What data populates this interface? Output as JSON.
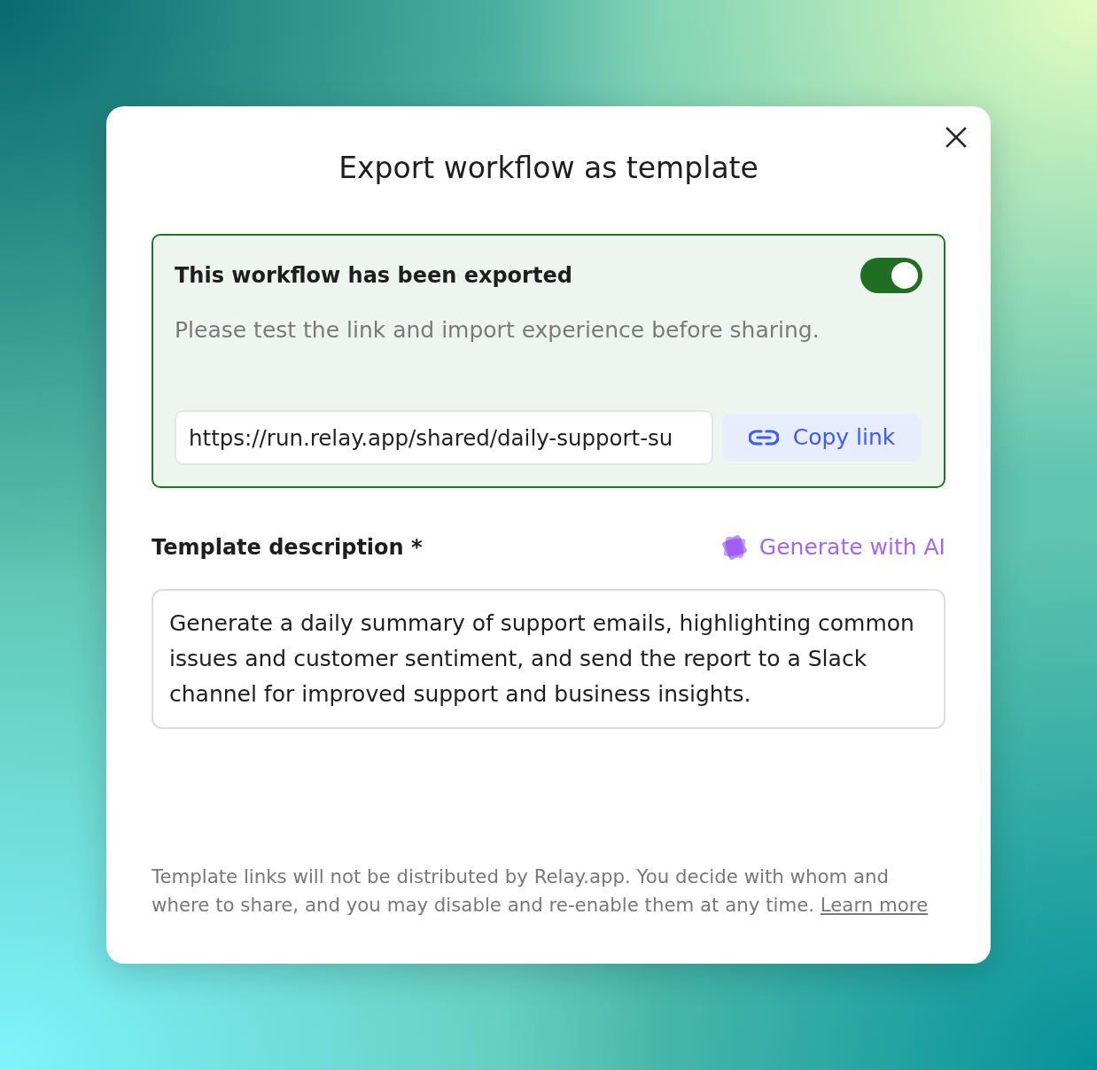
{
  "dialog": {
    "title": "Export workflow as template"
  },
  "export_panel": {
    "heading": "This workflow has been exported",
    "exported": true,
    "note": "Please test the link and import experience before sharing.",
    "link_field": {
      "value": "https://run.relay.app/shared/daily-support-su"
    },
    "copy_button": "Copy link"
  },
  "description": {
    "label": "Template description *",
    "generate_button": "Generate with AI",
    "value": "Generate a daily summary of support emails, highlighting common issues and customer sentiment, and send the report to a Slack channel for improved support and business insights."
  },
  "footer": {
    "text": "Template links will not be distributed by Relay.app. You decide with whom and where to share, and you may disable and re-enable them at any time.",
    "link": "Learn more"
  }
}
